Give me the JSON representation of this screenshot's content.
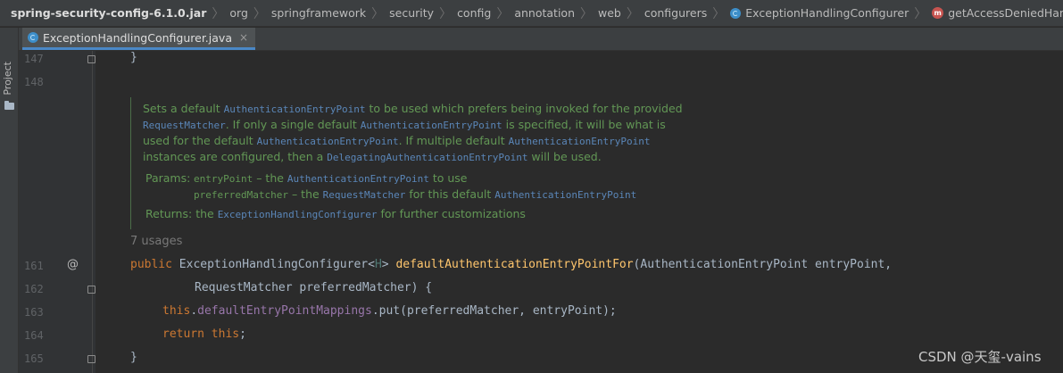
{
  "breadcrumbs": [
    "spring-security-config-6.1.0.jar",
    "org",
    "springframework",
    "security",
    "config",
    "annotation",
    "web",
    "configurers",
    "ExceptionHandlingConfigurer",
    "getAccessDeniedHandler"
  ],
  "tab": {
    "label": "ExceptionHandlingConfigurer.java",
    "close": "×"
  },
  "sidebar": {
    "project_label": "Project"
  },
  "gutter": {
    "lines": [
      "147",
      "148",
      "161",
      "162",
      "163",
      "164",
      "165"
    ],
    "override_marker": "@"
  },
  "code": {
    "line147": "}",
    "l161_public": "public",
    "l161_type": "ExceptionHandlingConfigurer<",
    "l161_generic": "H",
    "l161_close": "> ",
    "l161_method": "defaultAuthenticationEntryPointFor",
    "l161_params": "(AuthenticationEntryPoint entryPoint,",
    "l162": "RequestMatcher preferredMatcher) {",
    "l163_this": "this",
    "l163_dot": ".",
    "l163_field": "defaultEntryPointMappings",
    "l163_rest": ".put(preferredMatcher, entryPoint);",
    "l164_return": "return",
    "l164_this": "this",
    "l164_semi": ";",
    "line165": "}"
  },
  "doc": {
    "l1a": "Sets a default ",
    "l1b": "AuthenticationEntryPoint",
    "l1c": " to be used which prefers being invoked for the provided",
    "l2a": "RequestMatcher",
    "l2b": ". If only a single default ",
    "l2c": "AuthenticationEntryPoint",
    "l2d": " is specified, it will be what is",
    "l3a": "used for the default ",
    "l3b": "AuthenticationEntryPoint",
    "l3c": ". If multiple default ",
    "l3d": "AuthenticationEntryPoint",
    "l4a": "instances are configured, then a ",
    "l4b": "DelegatingAuthenticationEntryPoint",
    "l4c": " will be used.",
    "params_label": "Params:",
    "p1a": "entryPoint",
    "p1b": " – the ",
    "p1c": "AuthenticationEntryPoint",
    "p1d": " to use",
    "p2a": "preferredMatcher",
    "p2b": " – the ",
    "p2c": "RequestMatcher",
    "p2d": " for this default ",
    "p2e": "AuthenticationEntryPoint",
    "returns_label": "Returns:",
    "r1a": " the ",
    "r1b": "ExceptionHandlingConfigurer",
    "r1c": " for further customizations"
  },
  "usages": "7 usages",
  "watermark": "CSDN @天玺-vains"
}
